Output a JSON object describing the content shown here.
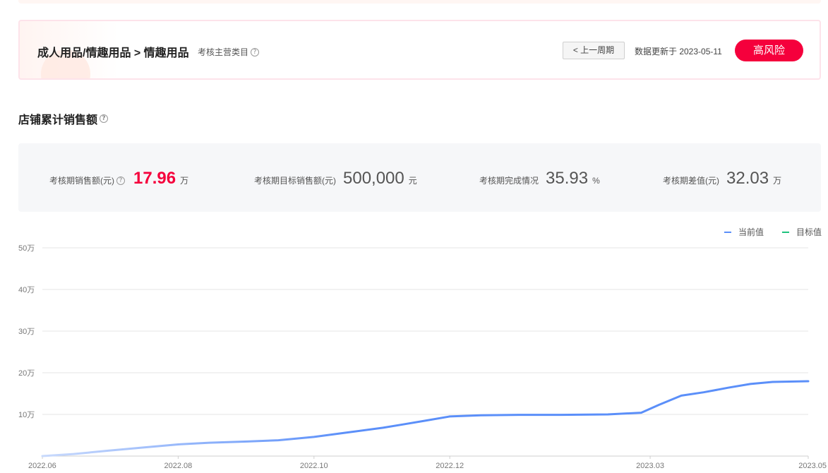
{
  "category_card": {
    "breadcrumb": "成人用品/情趣用品 > 情趣用品",
    "category_note": "考核主营类目",
    "prev_period_label": "< 上一周期",
    "update_text": "数据更新于 2023-05-11",
    "risk_label": "高风险"
  },
  "section": {
    "title": "店铺累计销售额"
  },
  "metrics": [
    {
      "label": "考核期销售额(元)",
      "value": "17.96",
      "unit": "万",
      "help": true,
      "highlight": true
    },
    {
      "label": "考核期目标销售额(元)",
      "value": "500,000",
      "unit": "元",
      "help": false,
      "highlight": false
    },
    {
      "label": "考核期完成情况",
      "value": "35.93",
      "unit": "%",
      "help": false,
      "highlight": false
    },
    {
      "label": "考核期差值(元)",
      "value": "32.03",
      "unit": "万",
      "help": false,
      "highlight": false
    }
  ],
  "colors": {
    "current": "#5b8ff9",
    "target": "#1ec37e",
    "risk": "#f5003c"
  },
  "chart_data": {
    "type": "line",
    "legend_position": "top-right",
    "grid": true,
    "y_ticks": [
      "50万",
      "40万",
      "30万",
      "20万",
      "10万"
    ],
    "y_tick_values": [
      50,
      40,
      30,
      20,
      10
    ],
    "ylim": [
      0,
      50
    ],
    "x_ticks": [
      "2022.06",
      "2022.08",
      "2022.10",
      "2022.12",
      "2023.03",
      "2023.05"
    ],
    "x_range": [
      "2022-06-01",
      "2023-05-11"
    ],
    "series": [
      {
        "name": "当前值",
        "color": "#5b8ff9",
        "points": [
          [
            "2022-06-01",
            0
          ],
          [
            "2022-06-15",
            0.5
          ],
          [
            "2022-07-01",
            1.3
          ],
          [
            "2022-07-15",
            2.0
          ],
          [
            "2022-08-01",
            2.8
          ],
          [
            "2022-08-15",
            3.2
          ],
          [
            "2022-09-01",
            3.5
          ],
          [
            "2022-09-15",
            3.8
          ],
          [
            "2022-10-01",
            4.6
          ],
          [
            "2022-10-15",
            5.6
          ],
          [
            "2022-11-01",
            6.8
          ],
          [
            "2022-11-10",
            7.6
          ],
          [
            "2022-11-20",
            8.5
          ],
          [
            "2022-12-01",
            9.5
          ],
          [
            "2022-12-15",
            9.8
          ],
          [
            "2023-01-01",
            9.9
          ],
          [
            "2023-01-20",
            9.9
          ],
          [
            "2023-02-10",
            10.0
          ],
          [
            "2023-02-25",
            10.4
          ],
          [
            "2023-03-05",
            12.3
          ],
          [
            "2023-03-15",
            14.5
          ],
          [
            "2023-03-25",
            15.3
          ],
          [
            "2023-04-05",
            16.4
          ],
          [
            "2023-04-15",
            17.3
          ],
          [
            "2023-04-25",
            17.8
          ],
          [
            "2023-05-11",
            17.96
          ]
        ]
      },
      {
        "name": "目标值",
        "color": "#1ec37e",
        "points": [
          [
            "2022-06-01",
            50
          ],
          [
            "2023-05-11",
            50
          ]
        ]
      }
    ]
  }
}
